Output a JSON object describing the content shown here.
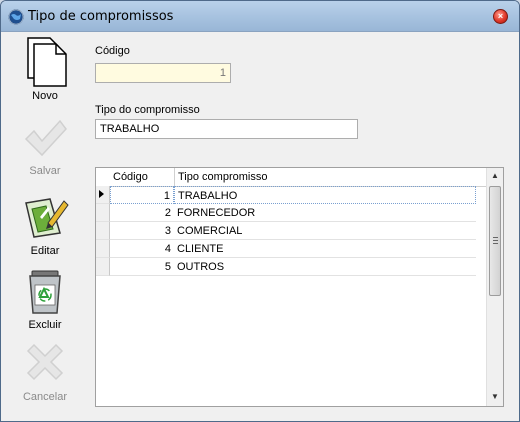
{
  "window": {
    "title": "Tipo de compromissos",
    "close_symbol": "×"
  },
  "toolbar": {
    "novo": "Novo",
    "salvar": "Salvar",
    "editar": "Editar",
    "excluir": "Excluir",
    "cancelar": "Cancelar"
  },
  "form": {
    "codigo_label": "Código",
    "codigo_value": "1",
    "tipo_label": "Tipo do compromisso",
    "tipo_value": "TRABALHO"
  },
  "grid": {
    "columns": [
      "Código",
      "Tipo compromisso"
    ],
    "rows": [
      {
        "codigo": "1",
        "tipo": "TRABALHO"
      },
      {
        "codigo": "2",
        "tipo": "FORNECEDOR"
      },
      {
        "codigo": "3",
        "tipo": "COMERCIAL"
      },
      {
        "codigo": "4",
        "tipo": "CLIENTE"
      },
      {
        "codigo": "5",
        "tipo": "OUTROS"
      }
    ],
    "selected_index": 0,
    "scroll_up": "▲",
    "scroll_down": "▼"
  }
}
